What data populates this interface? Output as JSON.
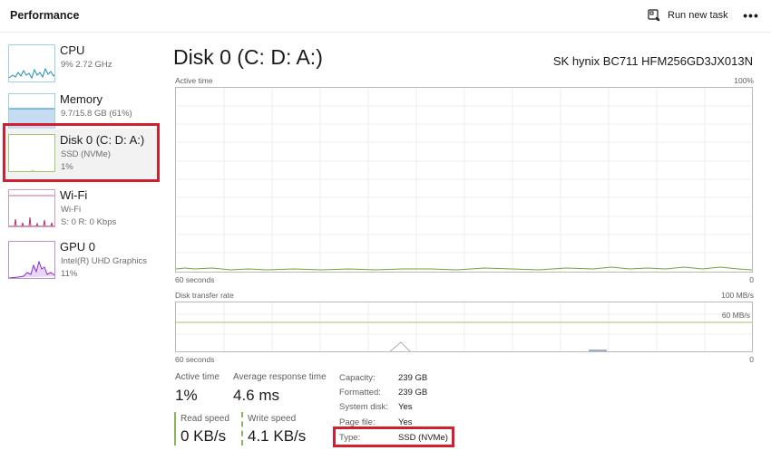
{
  "header": {
    "title": "Performance",
    "run_new_task_label": "Run new task",
    "more_label": "•••"
  },
  "sidebar": {
    "items": [
      {
        "name": "CPU",
        "line1": "9%  2.72 GHz",
        "line2": ""
      },
      {
        "name": "Memory",
        "line1": "9.7/15.8 GB (61%)",
        "line2": ""
      },
      {
        "name": "Disk 0 (C: D: A:)",
        "line1": "SSD (NVMe)",
        "line2": "1%"
      },
      {
        "name": "Wi-Fi",
        "line1": "Wi-Fi",
        "line2": "S: 0  R: 0 Kbps"
      },
      {
        "name": "GPU 0",
        "line1": "Intel(R) UHD Graphics",
        "line2": "11%"
      }
    ],
    "selected_index": 2
  },
  "main": {
    "title": "Disk 0 (C: D: A:)",
    "model": "SK hynix BC711 HFM256GD3JX013N",
    "active_time_graph": {
      "label": "Active time",
      "max_label": "100%",
      "x_left_label": "60 seconds",
      "x_right_label": "0"
    },
    "transfer_graph": {
      "label": "Disk transfer rate",
      "max_label": "100 MB/s",
      "ref_label": "60 MB/s",
      "x_left_label": "60 seconds",
      "x_right_label": "0"
    },
    "stats": {
      "active_time_label": "Active time",
      "active_time_value": "1%",
      "avg_response_label": "Average response time",
      "avg_response_value": "4.6 ms",
      "read_speed_label": "Read speed",
      "read_speed_value": "0 KB/s",
      "write_speed_label": "Write speed",
      "write_speed_value": "4.1 KB/s"
    },
    "properties": [
      {
        "label": "Capacity:",
        "value": "239 GB"
      },
      {
        "label": "Formatted:",
        "value": "239 GB"
      },
      {
        "label": "System disk:",
        "value": "Yes"
      },
      {
        "label": "Page file:",
        "value": "Yes"
      },
      {
        "label": "Type:",
        "value": "SSD (NVMe)"
      }
    ]
  },
  "colors": {
    "disk_line": "#6aa83a",
    "highlight": "#d11f2f",
    "cpu_line": "#1b8fb5",
    "memory_fill": "#c6dcf3",
    "wifi_line": "#b0306a",
    "gpu_line": "#8a2fbf"
  }
}
